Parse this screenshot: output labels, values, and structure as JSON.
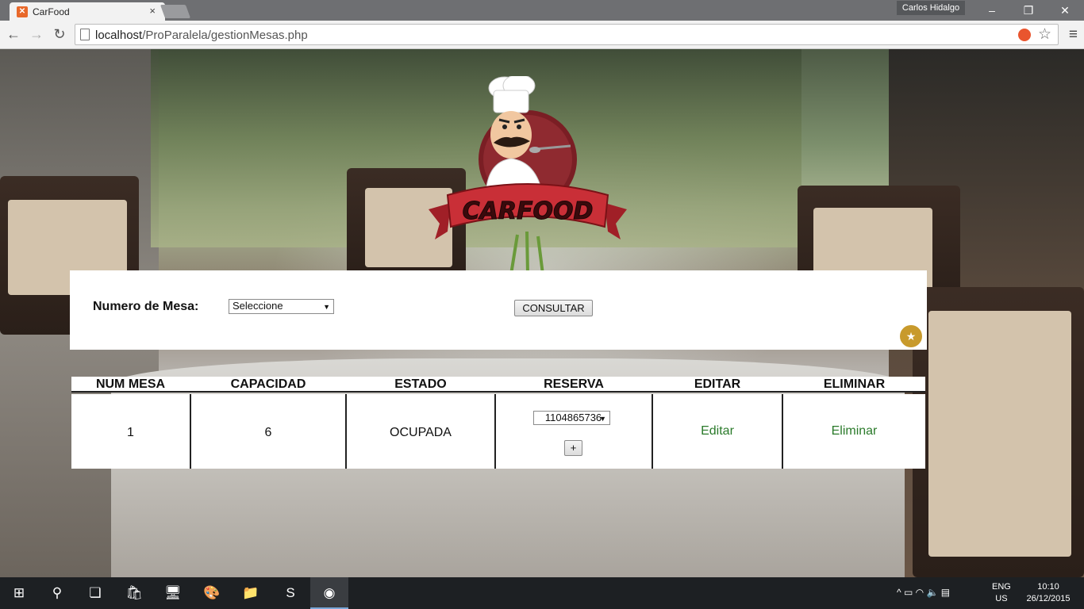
{
  "browser": {
    "tab_title": "CarFood",
    "tab_favicon_glyph": "✕",
    "tab_close": "×",
    "profile_name": "Carlos Hidalgo",
    "url_host": "localhost",
    "url_path": "/ProParalela/gestionMesas.php",
    "window_controls": {
      "minimize": "–",
      "restore": "❐",
      "close": "✕"
    },
    "nav": {
      "back": "←",
      "forward": "→",
      "reload": "↻"
    },
    "star_glyph": "☆",
    "menu_glyph": "≡"
  },
  "logo": {
    "brand": "CARFOOD",
    "icon": "chef-logo-icon"
  },
  "search": {
    "label": "Numero de Mesa:",
    "select_value": "Seleccione",
    "consult_button": "CONSULTAR",
    "favorite_icon": "star-badge-icon",
    "favorite_glyph": "★"
  },
  "table": {
    "headers": [
      "NUM MESA",
      "CAPACIDAD",
      "ESTADO",
      "RESERVA",
      "EDITAR",
      "ELIMINAR"
    ],
    "rows": [
      {
        "num": "1",
        "capacity": "6",
        "state": "OCUPADA",
        "reservation": "1104865736",
        "add": "+",
        "edit": "Editar",
        "delete": "Eliminar"
      }
    ]
  },
  "colors": {
    "link": "#2a7a2a",
    "badge": "#c89a2c",
    "taskbar": "#1d2023"
  },
  "taskbar": {
    "items": [
      "windows-start-icon",
      "search-icon",
      "task-view-icon",
      "store-icon",
      "control-panel-icon",
      "paint-icon",
      "file-explorer-icon",
      "sublime-text-icon",
      "chrome-icon"
    ],
    "glyphs": [
      "⊞",
      "⚲",
      "❏",
      "🛍",
      "🖥",
      "🎨",
      "📁",
      "S",
      "◉"
    ],
    "tray_glyphs": "^  ▭  ◠  🔈  ▤",
    "lang_1": "ENG",
    "lang_2": "US",
    "time": "10:10",
    "date": "26/12/2015"
  }
}
